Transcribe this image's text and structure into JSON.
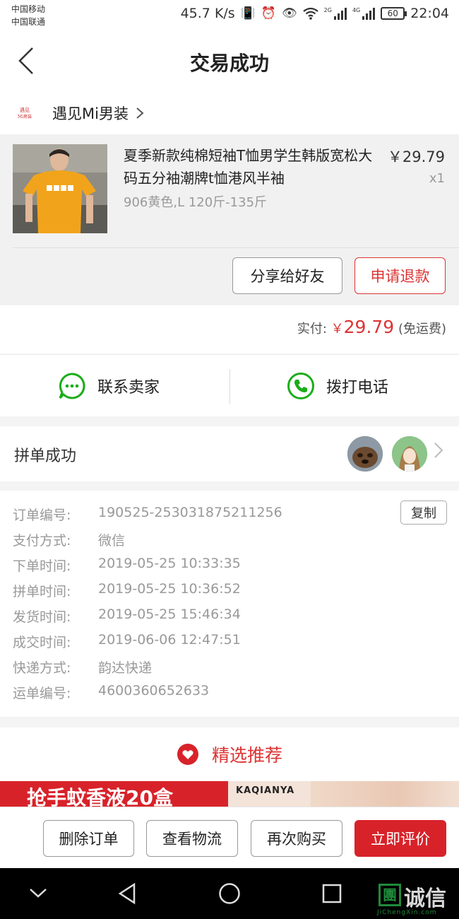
{
  "status_bar": {
    "carrier_1": "中国移动",
    "carrier_2": "中国联通",
    "speed": "45.7 K/s",
    "net_tag_1": "2G",
    "net_tag_2": "4G",
    "battery": "60",
    "time": "22:04"
  },
  "header": {
    "title": "交易成功"
  },
  "shop": {
    "name": "遇见Mi男装",
    "logo_text": "遇见Mi男装"
  },
  "product": {
    "title": "夏季新款纯棉短袖T恤男学生韩版宽松大码五分袖潮牌t恤港风半袖",
    "sku": "906黄色,L 120斤-135斤",
    "price": "￥29.79",
    "qty": "x1",
    "share_label": "分享给好友",
    "refund_label": "申请退款"
  },
  "payment": {
    "label": "实付:",
    "currency": "￥",
    "amount": "29.79",
    "note": "(免运费)"
  },
  "contact": {
    "seller_label": "联系卖家",
    "call_label": "拨打电话"
  },
  "group": {
    "label": "拼单成功"
  },
  "order_info": {
    "copy_label": "复制",
    "rows": [
      {
        "label": "订单编号:",
        "value": "190525-253031875211256"
      },
      {
        "label": "支付方式:",
        "value": "微信"
      },
      {
        "label": "下单时间:",
        "value": "2019-05-25 10:33:35"
      },
      {
        "label": "拼单时间:",
        "value": "2019-05-25 10:36:52"
      },
      {
        "label": "发货时间:",
        "value": "2019-05-25 15:46:34"
      },
      {
        "label": "成交时间:",
        "value": "2019-06-06 12:47:51"
      },
      {
        "label": "快递方式:",
        "value": "韵达快递"
      },
      {
        "label": "运单编号:",
        "value": "4600360652633"
      }
    ]
  },
  "recommend": {
    "title": "精选推荐",
    "banner_text": "抢手蚊香液20盒",
    "banner_brand": "KAQIANYA"
  },
  "actions": {
    "delete_label": "删除订单",
    "logistics_label": "查看物流",
    "rebuy_label": "再次购买",
    "review_label": "立即评价"
  },
  "watermark": {
    "mark": "團",
    "text": "诚信",
    "sub": "JiChengXin.com"
  },
  "colors": {
    "accent_red": "#d8222a",
    "wechat_green": "#1aad19"
  }
}
